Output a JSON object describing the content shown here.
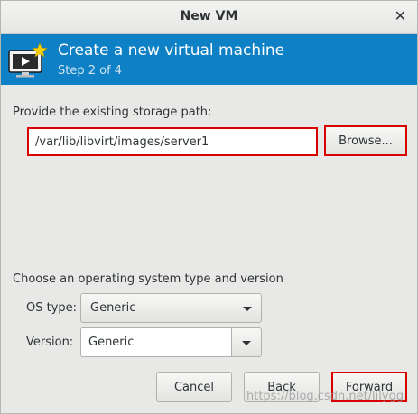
{
  "window": {
    "title": "New VM",
    "close_glyph": "✕"
  },
  "banner": {
    "icon": "vm-monitor-icon",
    "title": "Create a new virtual machine",
    "step": "Step 2 of 4",
    "color": "#0e80c6"
  },
  "storage": {
    "label": "Provide the existing storage path:",
    "path_value": "/var/lib/libvirt/images/server1",
    "browse_label": "Browse..."
  },
  "os": {
    "section_label": "Choose an operating system type and version",
    "type_label": "OS type:",
    "type_value": "Generic",
    "version_label": "Version:",
    "version_value": "Generic"
  },
  "buttons": {
    "cancel": "Cancel",
    "back": "Back",
    "forward": "Forward"
  },
  "watermark": "https://blog.csdn.net/lilygg",
  "colors": {
    "highlight_border": "#d80000"
  }
}
